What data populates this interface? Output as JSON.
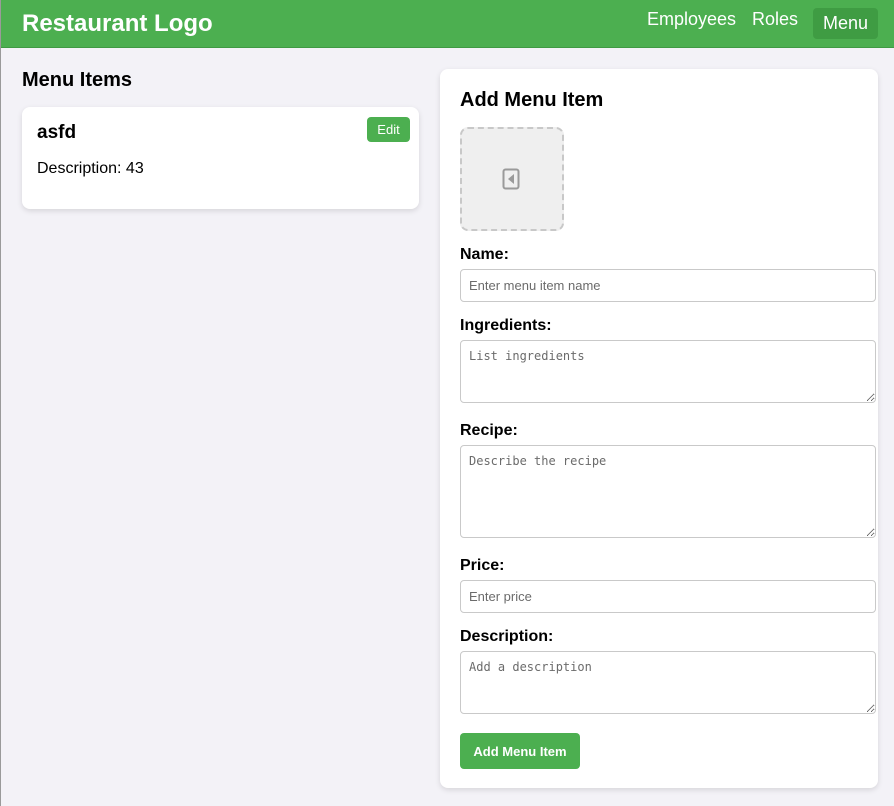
{
  "nav": {
    "logo": "Restaurant Logo",
    "links": [
      "Employees",
      "Roles",
      "Menu"
    ],
    "active": "Menu"
  },
  "menu_list": {
    "title": "Menu Items",
    "items": [
      {
        "name": "asfd",
        "description": "Description: 43",
        "edit_label": "Edit"
      }
    ]
  },
  "form": {
    "title": "Add Menu Item",
    "image_icon": "image-upload-icon",
    "name_label": "Name:",
    "name_placeholder": "Enter menu item name",
    "ingredients_label": "Ingredients:",
    "ingredients_placeholder": "List ingredients",
    "recipe_label": "Recipe:",
    "recipe_placeholder": "Describe the recipe",
    "price_label": "Price:",
    "price_placeholder": "Enter price",
    "description_label": "Description:",
    "description_placeholder": "Add a description",
    "submit_label": "Add Menu Item"
  },
  "colors": {
    "brand": "#4caf50",
    "active_nav": "#3f9c43",
    "background": "#f3f2f7"
  }
}
